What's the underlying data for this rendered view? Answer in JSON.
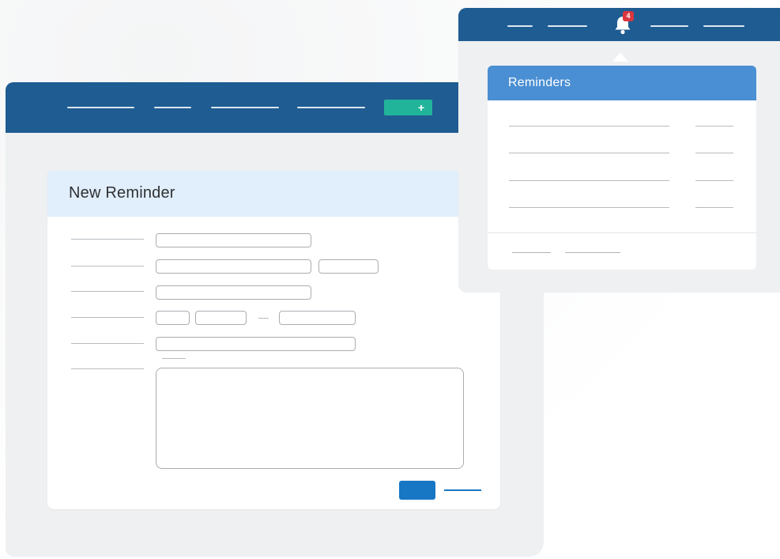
{
  "main_window": {
    "add_button_icon": "plus-icon",
    "add_button_symbol": "+"
  },
  "form": {
    "title": "New Reminder",
    "save_icon": "save-button",
    "cancel_icon": "cancel-link"
  },
  "reminders_window": {
    "notification_icon": "bell-icon",
    "notification_count": "4",
    "panel_title": "Reminders"
  },
  "colors": {
    "header_blue": "#1f5c92",
    "accent_teal": "#22b49a",
    "primary_blue": "#1877c4",
    "panel_header": "#4a8fd3",
    "badge_red": "#d9363e",
    "form_header_bg": "#e1eefb"
  }
}
